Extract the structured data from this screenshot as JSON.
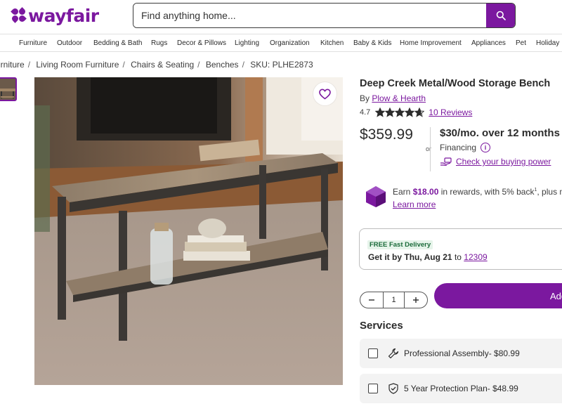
{
  "header": {
    "logo_text": "wayfair",
    "search_placeholder": "Find anything home...",
    "brand_color": "#7b189f"
  },
  "nav": {
    "items": [
      "Furniture",
      "Outdoor",
      "Bedding & Bath",
      "Rugs",
      "Decor & Pillows",
      "Lighting",
      "Organization",
      "Kitchen",
      "Baby & Kids",
      "Home Improvement",
      "Appliances",
      "Pet",
      "Holiday"
    ]
  },
  "breadcrumb": {
    "items": [
      "urniture",
      "Living Room Furniture",
      "Chairs & Seating",
      "Benches"
    ],
    "sku": "SKU: PLHE2873",
    "separator": "/"
  },
  "product": {
    "title": "Deep Creek Metal/Wood Storage Bench",
    "by": "By",
    "brand": "Plow & Hearth",
    "rating": "4.7",
    "stars": 4.7,
    "reviews": "10 Reviews",
    "price": "$359.99",
    "or": "or",
    "monthly": "$30/mo.",
    "monthly_term": "over 12 months",
    "financing": "Financing",
    "buying_power": "Check your buying power",
    "rewards_prefix": "Earn",
    "rewards_amount": "$18.00",
    "rewards_suffix": "in rewards, with 5% back",
    "rewards_tail": ", plus m",
    "learn_more": "Learn more"
  },
  "delivery": {
    "badge": "FREE Fast Delivery",
    "get_by_prefix": "Get it by",
    "get_by_date": "Thu, Aug 21",
    "to": "to",
    "zip": "12309"
  },
  "cart": {
    "quantity": "1",
    "add_label": "Add"
  },
  "services": {
    "heading": "Services",
    "items": [
      {
        "label": "Professional Assembly- $80.99",
        "icon": "wrench-icon"
      },
      {
        "label": "5 Year Protection Plan- $48.99",
        "icon": "shield-check-icon"
      }
    ]
  }
}
